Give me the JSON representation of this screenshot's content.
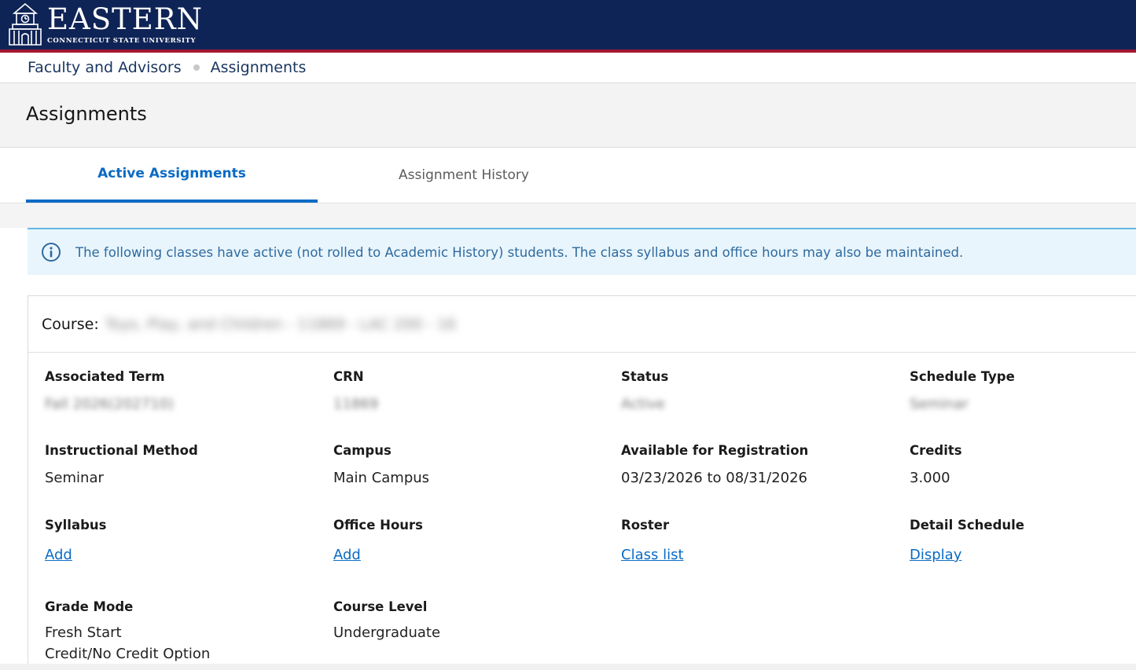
{
  "header": {
    "logo_main": "EASTERN",
    "logo_sub": "CONNECTICUT STATE UNIVERSITY",
    "brand_color": "#0f2456",
    "accent_color": "#a4162f"
  },
  "breadcrumb": {
    "items": [
      "Faculty and Advisors",
      "Assignments"
    ]
  },
  "page": {
    "title": "Assignments"
  },
  "tabs": [
    {
      "label": "Active Assignments",
      "active": true
    },
    {
      "label": "Assignment History",
      "active": false
    }
  ],
  "banner": {
    "icon": "info-icon",
    "text": "The following classes have active (not rolled to Academic History) students. The class syllabus and office hours may also be maintained."
  },
  "course": {
    "label": "Course:",
    "value": "Toys, Play, and Children - 11869 - LAC 200 - 16",
    "fields": {
      "associated_term": {
        "label": "Associated Term",
        "value": "Fall 2026(202710)"
      },
      "crn": {
        "label": "CRN",
        "value": "11869"
      },
      "status": {
        "label": "Status",
        "value": "Active"
      },
      "schedule_type": {
        "label": "Schedule Type",
        "value": "Seminar"
      },
      "instructional_method": {
        "label": "Instructional Method",
        "value": "Seminar"
      },
      "campus": {
        "label": "Campus",
        "value": "Main Campus"
      },
      "available": {
        "label": "Available for Registration",
        "value": "03/23/2026 to 08/31/2026"
      },
      "credits": {
        "label": "Credits",
        "value": "3.000"
      },
      "syllabus": {
        "label": "Syllabus",
        "link": "Add"
      },
      "office_hours": {
        "label": "Office Hours",
        "link": "Add"
      },
      "roster": {
        "label": "Roster",
        "link": "Class list"
      },
      "detail_schedule": {
        "label": "Detail Schedule",
        "link": "Display"
      },
      "grade_mode": {
        "label": "Grade Mode",
        "value_line1": "Fresh Start",
        "value_line2": "Credit/No Credit Option"
      },
      "course_level": {
        "label": "Course Level",
        "value": "Undergraduate"
      }
    }
  }
}
